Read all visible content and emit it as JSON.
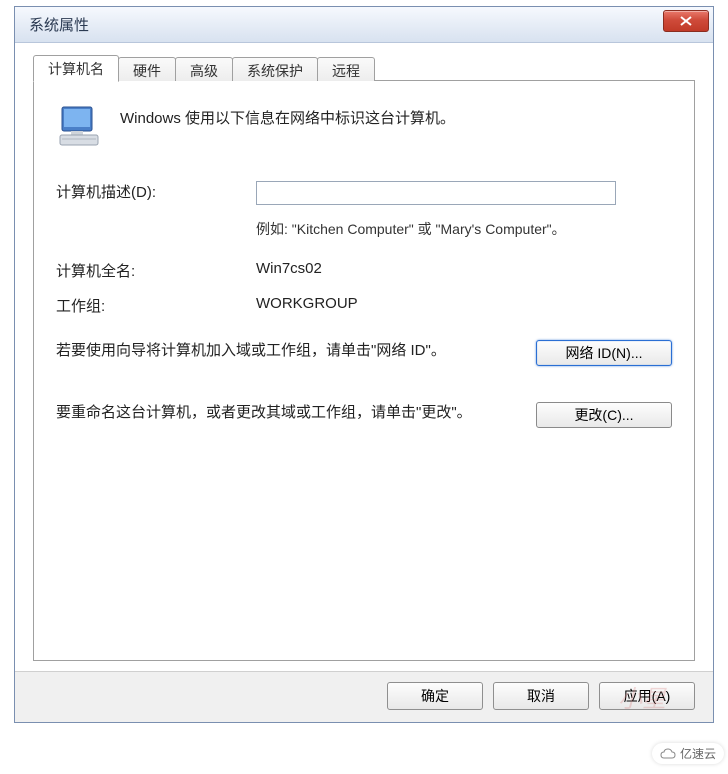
{
  "window": {
    "title": "系统属性"
  },
  "tabs": [
    {
      "label": "计算机名",
      "active": true
    },
    {
      "label": "硬件",
      "active": false
    },
    {
      "label": "高级",
      "active": false
    },
    {
      "label": "系统保护",
      "active": false
    },
    {
      "label": "远程",
      "active": false
    }
  ],
  "intro": "Windows 使用以下信息在网络中标识这台计算机。",
  "description": {
    "label": "计算机描述(D):",
    "value": "",
    "example": "例如: \"Kitchen Computer\" 或 \"Mary's Computer\"。"
  },
  "fullname": {
    "label": "计算机全名:",
    "value": "Win7cs02"
  },
  "workgroup": {
    "label": "工作组:",
    "value": "WORKGROUP"
  },
  "networkid": {
    "text": "若要使用向导将计算机加入域或工作组，请单击\"网络 ID\"。",
    "button": "网络 ID(N)..."
  },
  "change": {
    "text": "要重命名这台计算机，或者更改其域或工作组，请单击\"更改\"。",
    "button": "更改(C)..."
  },
  "buttons": {
    "ok": "确定",
    "cancel": "取消",
    "apply": "应用(A)"
  },
  "badge": "亿速云"
}
